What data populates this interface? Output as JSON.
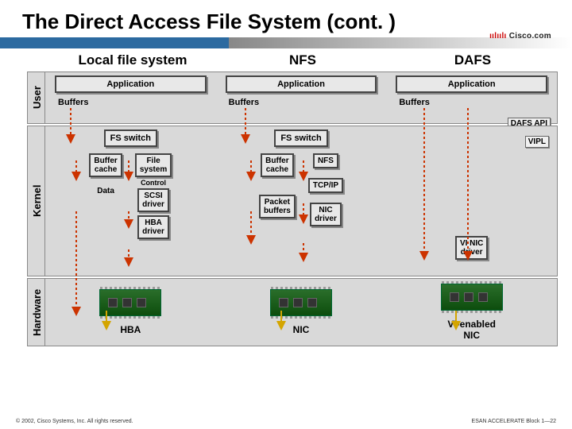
{
  "title": "The Direct Access File System (cont. )",
  "logo": "Cisco.com",
  "columns": {
    "local": "Local file system",
    "nfs": "NFS",
    "dafs": "DAFS"
  },
  "layers": {
    "user": "User",
    "kernel": "Kernel",
    "hardware": "Hardware"
  },
  "labels": {
    "application": "Application",
    "buffers": "Buffers",
    "fs_switch": "FS switch",
    "buffer_cache": "Buffer\ncache",
    "file_system": "File\nsystem",
    "control": "Control",
    "scsi_driver": "SCSI\ndriver",
    "data": "Data",
    "hba_driver": "HBA\ndriver",
    "packet_buffers": "Packet\nbuffers",
    "nfs_box": "NFS",
    "tcpip": "TCP/IP",
    "nic_driver": "NIC\ndriver",
    "vi_nic_driver": "VI NIC\ndriver",
    "dafs_api": "DAFS API",
    "vipl": "VIPL",
    "hba": "HBA",
    "nic": "NIC",
    "vi_nic": "VI-enabled\nNIC"
  },
  "footer": {
    "left": "© 2002, Cisco Systems, Inc. All rights reserved.",
    "right": "ESAN ACCELERATE Block 1—22"
  },
  "colors": {
    "accent": "#2c6aa0",
    "arrow_red": "#cc3300",
    "arrow_yellow": "#ffcc00",
    "chip": "#1a5a1a"
  }
}
